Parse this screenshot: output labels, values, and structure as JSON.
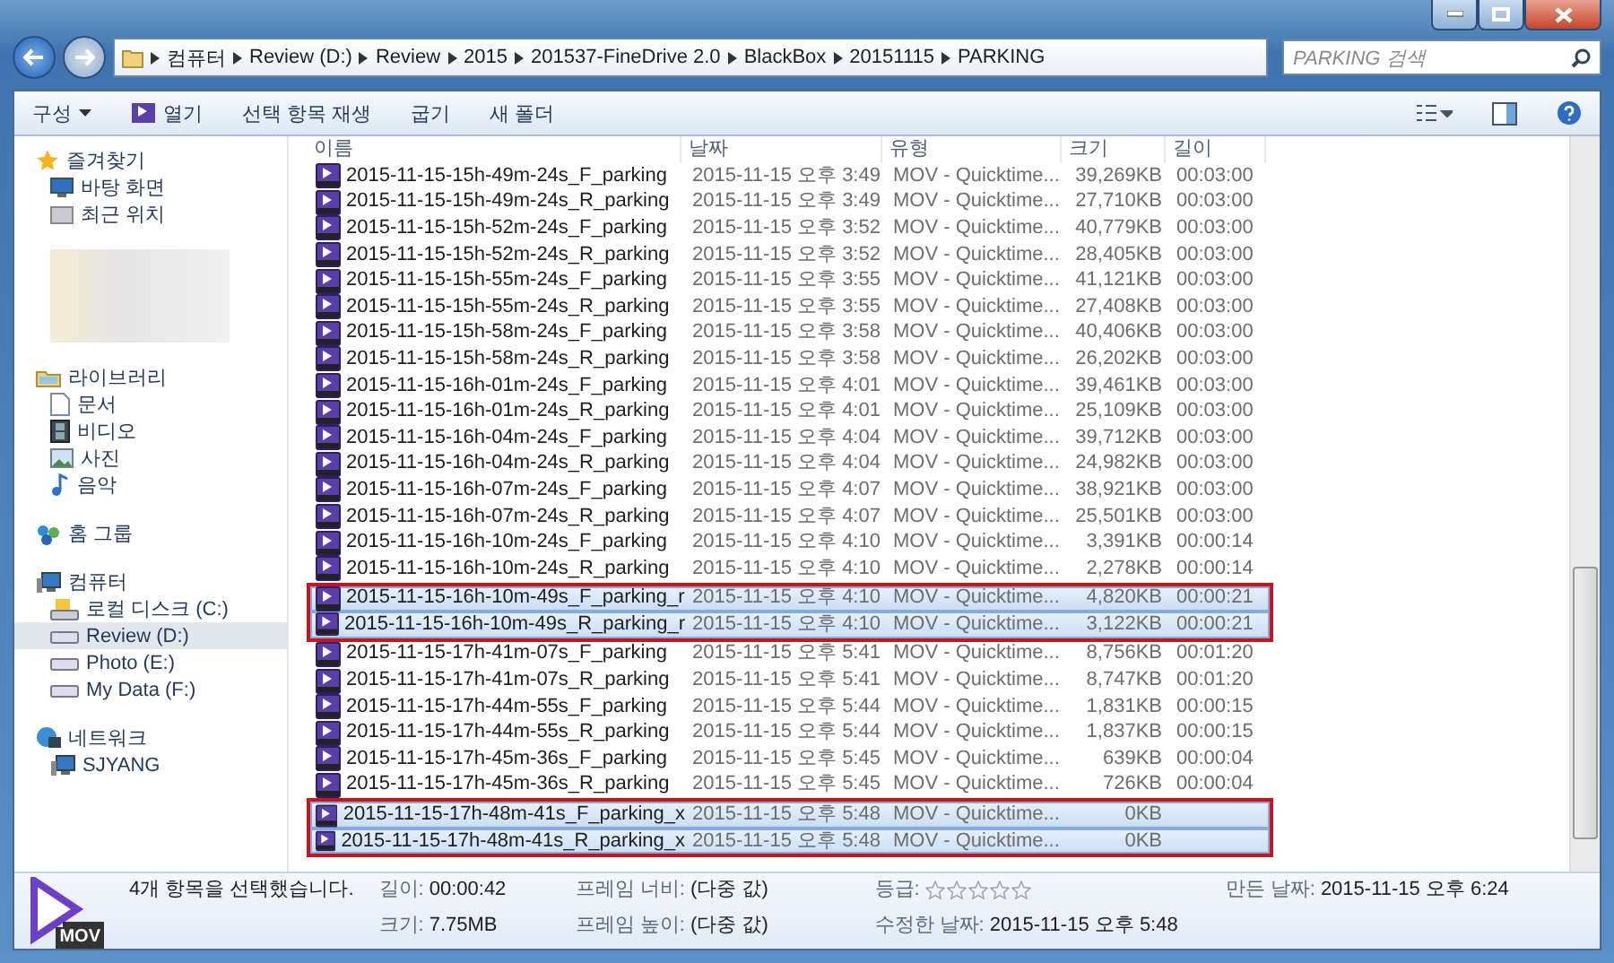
{
  "address": {
    "crumbs": [
      "컴퓨터",
      "Review (D:)",
      "Review",
      "2015",
      "201537-FineDrive 2.0",
      "BlackBox",
      "20151115",
      "PARKING"
    ],
    "search_placeholder": "PARKING 검색"
  },
  "toolbar": {
    "items": [
      {
        "label": "구성",
        "kind": "menu"
      },
      {
        "label": "열기",
        "kind": "open"
      },
      {
        "label": "선택 항목 재생",
        "kind": "plain"
      },
      {
        "label": "굽기",
        "kind": "plain"
      },
      {
        "label": "새 폴더",
        "kind": "plain"
      }
    ]
  },
  "sidebar": [
    {
      "label": "즐겨찾기",
      "kind": "star",
      "selected": false,
      "children": [
        {
          "label": "바탕 화면",
          "kind": "desktop",
          "selected": false
        },
        {
          "label": "최근 위치",
          "kind": "recent",
          "selected": false
        }
      ]
    },
    {
      "kind": "blurred"
    },
    {
      "label": "라이브러리",
      "kind": "library",
      "selected": false,
      "children": [
        {
          "label": "문서",
          "kind": "doc",
          "selected": false
        },
        {
          "label": "비디오",
          "kind": "video",
          "selected": false
        },
        {
          "label": "사진",
          "kind": "picture",
          "selected": false
        },
        {
          "label": "음악",
          "kind": "music",
          "selected": false
        }
      ]
    },
    {
      "label": "홈 그룹",
      "kind": "homegroup",
      "selected": false
    },
    {
      "label": "컴퓨터",
      "kind": "computer",
      "selected": false,
      "children": [
        {
          "label": "로컬 디스크 (C:)",
          "kind": "sysdrive",
          "selected": false
        },
        {
          "label": "Review (D:)",
          "kind": "drive",
          "selected": true
        },
        {
          "label": "Photo (E:)",
          "kind": "drive",
          "selected": false
        },
        {
          "label": "My Data (F:)",
          "kind": "drive",
          "selected": false
        }
      ]
    },
    {
      "label": "네트워크",
      "kind": "network",
      "selected": false,
      "children": [
        {
          "label": "SJYANG",
          "kind": "computer",
          "selected": false
        }
      ]
    }
  ],
  "table": {
    "columns": [
      "이름",
      "날짜",
      "유형",
      "크기",
      "길이"
    ],
    "rows": [
      {
        "name": "2015-11-15-15h-49m-24s_F_parking",
        "date": "2015-11-15 오후 3:49",
        "type": "MOV - Quicktime...",
        "size": "39,269KB",
        "length": "00:03:00",
        "selected": false,
        "marked": false
      },
      {
        "name": "2015-11-15-15h-49m-24s_R_parking",
        "date": "2015-11-15 오후 3:49",
        "type": "MOV - Quicktime...",
        "size": "27,710KB",
        "length": "00:03:00",
        "selected": false,
        "marked": false
      },
      {
        "name": "2015-11-15-15h-52m-24s_F_parking",
        "date": "2015-11-15 오후 3:52",
        "type": "MOV - Quicktime...",
        "size": "40,779KB",
        "length": "00:03:00",
        "selected": false,
        "marked": false
      },
      {
        "name": "2015-11-15-15h-52m-24s_R_parking",
        "date": "2015-11-15 오후 3:52",
        "type": "MOV - Quicktime...",
        "size": "28,405KB",
        "length": "00:03:00",
        "selected": false,
        "marked": false
      },
      {
        "name": "2015-11-15-15h-55m-24s_F_parking",
        "date": "2015-11-15 오후 3:55",
        "type": "MOV - Quicktime...",
        "size": "41,121KB",
        "length": "00:03:00",
        "selected": false,
        "marked": false
      },
      {
        "name": "2015-11-15-15h-55m-24s_R_parking",
        "date": "2015-11-15 오후 3:55",
        "type": "MOV - Quicktime...",
        "size": "27,408KB",
        "length": "00:03:00",
        "selected": false,
        "marked": false
      },
      {
        "name": "2015-11-15-15h-58m-24s_F_parking",
        "date": "2015-11-15 오후 3:58",
        "type": "MOV - Quicktime...",
        "size": "40,406KB",
        "length": "00:03:00",
        "selected": false,
        "marked": false
      },
      {
        "name": "2015-11-15-15h-58m-24s_R_parking",
        "date": "2015-11-15 오후 3:58",
        "type": "MOV - Quicktime...",
        "size": "26,202KB",
        "length": "00:03:00",
        "selected": false,
        "marked": false
      },
      {
        "name": "2015-11-15-16h-01m-24s_F_parking",
        "date": "2015-11-15 오후 4:01",
        "type": "MOV - Quicktime...",
        "size": "39,461KB",
        "length": "00:03:00",
        "selected": false,
        "marked": false
      },
      {
        "name": "2015-11-15-16h-01m-24s_R_parking",
        "date": "2015-11-15 오후 4:01",
        "type": "MOV - Quicktime...",
        "size": "25,109KB",
        "length": "00:03:00",
        "selected": false,
        "marked": false
      },
      {
        "name": "2015-11-15-16h-04m-24s_F_parking",
        "date": "2015-11-15 오후 4:04",
        "type": "MOV - Quicktime...",
        "size": "39,712KB",
        "length": "00:03:00",
        "selected": false,
        "marked": false
      },
      {
        "name": "2015-11-15-16h-04m-24s_R_parking",
        "date": "2015-11-15 오후 4:04",
        "type": "MOV - Quicktime...",
        "size": "24,982KB",
        "length": "00:03:00",
        "selected": false,
        "marked": false
      },
      {
        "name": "2015-11-15-16h-07m-24s_F_parking",
        "date": "2015-11-15 오후 4:07",
        "type": "MOV - Quicktime...",
        "size": "38,921KB",
        "length": "00:03:00",
        "selected": false,
        "marked": false
      },
      {
        "name": "2015-11-15-16h-07m-24s_R_parking",
        "date": "2015-11-15 오후 4:07",
        "type": "MOV - Quicktime...",
        "size": "25,501KB",
        "length": "00:03:00",
        "selected": false,
        "marked": false
      },
      {
        "name": "2015-11-15-16h-10m-24s_F_parking",
        "date": "2015-11-15 오후 4:10",
        "type": "MOV - Quicktime...",
        "size": "3,391KB",
        "length": "00:00:14",
        "selected": false,
        "marked": false
      },
      {
        "name": "2015-11-15-16h-10m-24s_R_parking",
        "date": "2015-11-15 오후 4:10",
        "type": "MOV - Quicktime...",
        "size": "2,278KB",
        "length": "00:00:14",
        "selected": false,
        "marked": false
      },
      {
        "name": "2015-11-15-16h-10m-49s_F_parking_r",
        "date": "2015-11-15 오후 4:10",
        "type": "MOV - Quicktime...",
        "size": "4,820KB",
        "length": "00:00:21",
        "selected": true,
        "marked": true
      },
      {
        "name": "2015-11-15-16h-10m-49s_R_parking_r",
        "date": "2015-11-15 오후 4:10",
        "type": "MOV - Quicktime...",
        "size": "3,122KB",
        "length": "00:00:21",
        "selected": true,
        "marked": true
      },
      {
        "name": "2015-11-15-17h-41m-07s_F_parking",
        "date": "2015-11-15 오후 5:41",
        "type": "MOV - Quicktime...",
        "size": "8,756KB",
        "length": "00:01:20",
        "selected": false,
        "marked": false
      },
      {
        "name": "2015-11-15-17h-41m-07s_R_parking",
        "date": "2015-11-15 오후 5:41",
        "type": "MOV - Quicktime...",
        "size": "8,747KB",
        "length": "00:01:20",
        "selected": false,
        "marked": false
      },
      {
        "name": "2015-11-15-17h-44m-55s_F_parking",
        "date": "2015-11-15 오후 5:44",
        "type": "MOV - Quicktime...",
        "size": "1,831KB",
        "length": "00:00:15",
        "selected": false,
        "marked": false
      },
      {
        "name": "2015-11-15-17h-44m-55s_R_parking",
        "date": "2015-11-15 오후 5:44",
        "type": "MOV - Quicktime...",
        "size": "1,837KB",
        "length": "00:00:15",
        "selected": false,
        "marked": false
      },
      {
        "name": "2015-11-15-17h-45m-36s_F_parking",
        "date": "2015-11-15 오후 5:45",
        "type": "MOV - Quicktime...",
        "size": "639KB",
        "length": "00:00:04",
        "selected": false,
        "marked": false
      },
      {
        "name": "2015-11-15-17h-45m-36s_R_parking",
        "date": "2015-11-15 오후 5:45",
        "type": "MOV - Quicktime...",
        "size": "726KB",
        "length": "00:00:04",
        "selected": false,
        "marked": false
      },
      {
        "name": "2015-11-15-17h-48m-41s_F_parking_x",
        "date": "2015-11-15 오후 5:48",
        "type": "MOV - Quicktime...",
        "size": "0KB",
        "length": "",
        "selected": true,
        "marked": true
      },
      {
        "name": "2015-11-15-17h-48m-41s_R_parking_x",
        "date": "2015-11-15 오후 5:48",
        "type": "MOV - Quicktime...",
        "size": "0KB",
        "length": "",
        "selected": true,
        "marked": true
      }
    ]
  },
  "details": {
    "icon_label": "MOV",
    "summary": "4개 항목을 선택했습니다.",
    "fields": [
      {
        "label": "길이:",
        "value": "00:00:42",
        "kind": "text"
      },
      {
        "label": "크기:",
        "value": "7.75MB",
        "kind": "text"
      },
      {
        "label": "프레임 너비:",
        "value": "(다중 값)",
        "kind": "text"
      },
      {
        "label": "프레임 높이:",
        "value": "(다중 값)",
        "kind": "text"
      },
      {
        "label": "등급:",
        "stars": 0,
        "kind": "rating"
      },
      {
        "label": "수정한 날짜:",
        "value": "2015-11-15 오후 5:48",
        "kind": "text"
      },
      {
        "label": "만든 날짜:",
        "value": "2015-11-15 오후 6:24",
        "kind": "text"
      }
    ]
  }
}
